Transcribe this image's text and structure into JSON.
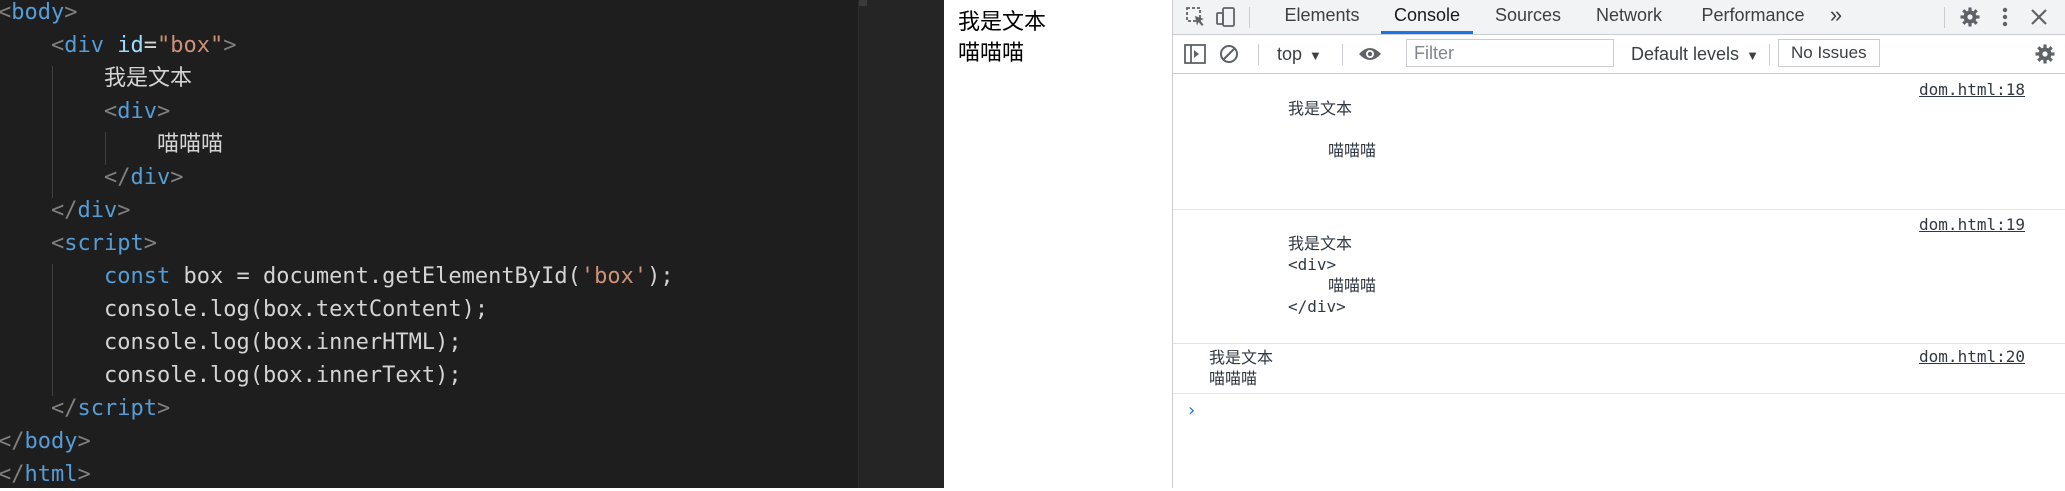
{
  "editor": {
    "lines": [
      {
        "open": "<",
        "tag": "body",
        "close": ">"
      },
      {
        "open": "<",
        "tag": "div",
        "attr": "id",
        "eq": "=",
        "val": "\"box\"",
        "close": ">"
      },
      {
        "text": "我是文本"
      },
      {
        "open": "<",
        "tag": "div",
        "close": ">"
      },
      {
        "text": "喵喵喵"
      },
      {
        "open": "</",
        "tag": "div",
        "close": ">"
      },
      {
        "open": "</",
        "tag": "div",
        "close": ">"
      },
      {
        "open": "<",
        "tag": "script",
        "close": ">"
      },
      {
        "kw": "const",
        "rest1": " box = document.getElementById(",
        "str": "'box'",
        "rest2": ");"
      },
      {
        "text": "console.log(box.textContent);"
      },
      {
        "text": "console.log(box.innerHTML);"
      },
      {
        "text": "console.log(box.innerText);"
      },
      {
        "open": "</",
        "tag": "script",
        "close": ">"
      },
      {
        "open": "</",
        "tag": "body",
        "close": ">"
      },
      {
        "open": "</",
        "tag": "html",
        "close": ">"
      }
    ]
  },
  "viewport": {
    "line1": "我是文本",
    "line2": "喵喵喵"
  },
  "devtools": {
    "tabs": [
      "Elements",
      "Console",
      "Sources",
      "Network",
      "Performance"
    ],
    "active_tab": "Console",
    "more_tabs": "»",
    "toolbar": {
      "context": "top",
      "filter_placeholder": "Filter",
      "levels": "Default levels",
      "issues": "No Issues"
    },
    "messages": [
      {
        "source": "dom.html:18",
        "line1": "我是文本",
        "line2": "喵喵喵"
      },
      {
        "source": "dom.html:19",
        "line1": "我是文本",
        "line2": "<div>",
        "line3": "喵喵喵",
        "line4": "</div>"
      },
      {
        "source": "dom.html:20",
        "line1": "我是文本",
        "line2": "喵喵喵"
      }
    ],
    "prompt": "›"
  },
  "colors": {
    "editor_bg": "#1e1e1e",
    "tag": "#569cd6",
    "attr": "#9cdcfe",
    "string": "#ce9178",
    "accent": "#1a73e8"
  },
  "icons": [
    "inspect-icon",
    "device-toggle-icon",
    "settings-icon",
    "kebab-menu-icon",
    "close-icon",
    "sidebar-toggle-icon",
    "clear-console-icon",
    "eye-icon",
    "console-settings-icon"
  ]
}
